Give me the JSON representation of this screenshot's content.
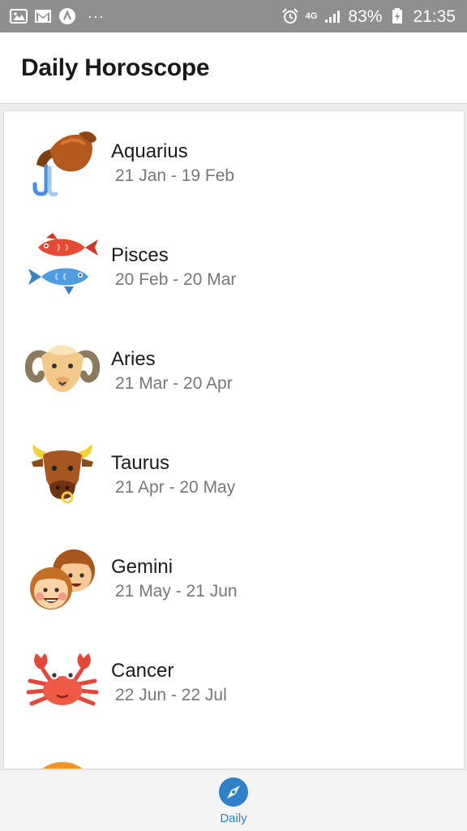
{
  "status_bar": {
    "left_icons": [
      "gallery-icon",
      "gmail-icon",
      "app-notification-icon",
      "more-dots-icon"
    ],
    "more_dots": "···",
    "network_type": "4G",
    "battery_percent": "83%",
    "time": "21:35"
  },
  "app_bar": {
    "title": "Daily Horoscope"
  },
  "signs": [
    {
      "name": "Aquarius",
      "dates": "21 Jan - 19 Feb",
      "icon": "aquarius-icon"
    },
    {
      "name": "Pisces",
      "dates": "20 Feb - 20 Mar",
      "icon": "pisces-icon"
    },
    {
      "name": "Aries",
      "dates": "21 Mar - 20 Apr",
      "icon": "aries-icon"
    },
    {
      "name": "Taurus",
      "dates": "21 Apr - 20 May",
      "icon": "taurus-icon"
    },
    {
      "name": "Gemini",
      "dates": "21 May - 21 Jun",
      "icon": "gemini-icon"
    },
    {
      "name": "Cancer",
      "dates": "22 Jun - 22 Jul",
      "icon": "cancer-icon"
    },
    {
      "name": "",
      "dates": "",
      "icon": "leo-icon"
    }
  ],
  "bottom_nav": {
    "tabs": [
      {
        "label": "Daily",
        "icon": "compass-icon",
        "active": true
      }
    ],
    "active_color": "#2f80c8"
  }
}
